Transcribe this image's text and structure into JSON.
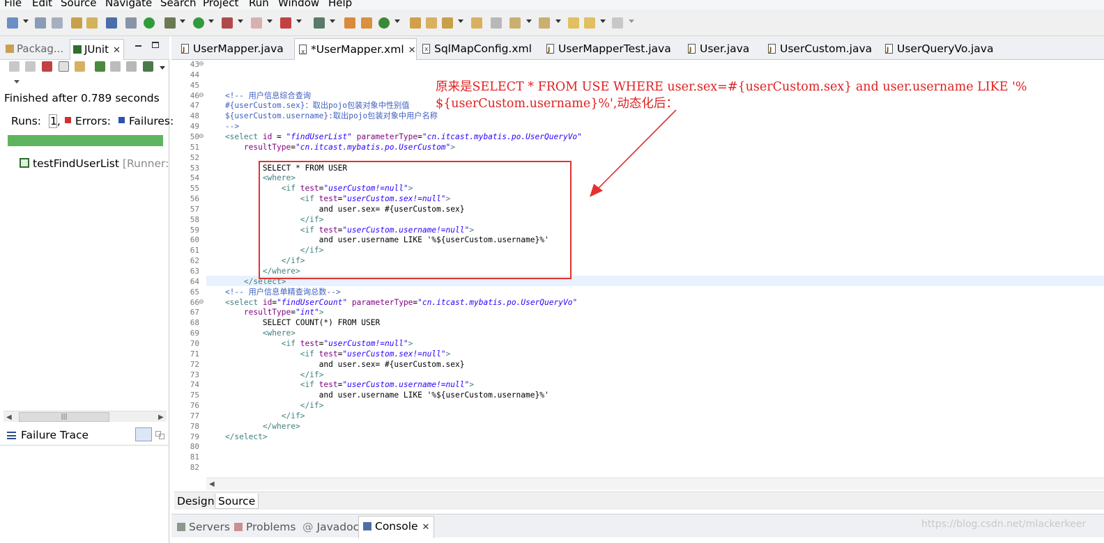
{
  "menu": [
    "File",
    "Edit",
    "Source",
    "Navigate",
    "Search",
    "Project",
    "Run",
    "Window",
    "Help"
  ],
  "left_panel": {
    "tabs": [
      {
        "label": "Packag..."
      },
      {
        "label": "JUnit",
        "close": "✕"
      }
    ],
    "status": "Finished after 0.789 seconds",
    "runs_label": "Runs:",
    "runs_value": "1,",
    "errors_label": "Errors:",
    "failures_label": "Failures:",
    "progress": 1.0,
    "progress_color": "#5fb55f",
    "tree_item": "testFindUserList",
    "tree_runner": "[Runner: JU",
    "failure_trace": "Failure Trace",
    "scroll_grip": "|||"
  },
  "editor_tabs": [
    {
      "label": "UserMapper.java",
      "type": "java",
      "active": false
    },
    {
      "label": "*UserMapper.xml",
      "type": "xml",
      "active": true,
      "close": "✕"
    },
    {
      "label": "SqlMapConfig.xml",
      "type": "xml",
      "active": false
    },
    {
      "label": "UserMapperTest.java",
      "type": "java",
      "active": false
    },
    {
      "label": "User.java",
      "type": "java",
      "active": false
    },
    {
      "label": "UserCustom.java",
      "type": "java",
      "active": false
    },
    {
      "label": "UserQueryVo.java",
      "type": "java",
      "active": false
    }
  ],
  "line_numbers": [
    "43",
    "44",
    "45",
    "46",
    "47",
    "48",
    "49",
    "50",
    "51",
    "52",
    "53",
    "54",
    "55",
    "56",
    "57",
    "58",
    "59",
    "60",
    "61",
    "62",
    "63",
    "64",
    "65",
    "66",
    "67",
    "68",
    "69",
    "70",
    "71",
    "72",
    "73",
    "74",
    "75",
    "76",
    "77",
    "78",
    "79",
    "80",
    "81",
    "82"
  ],
  "code": [
    [],
    [],
    [],
    [
      {
        "c": "comment",
        "t": "    <!-- 用户信息综合查询"
      }
    ],
    [
      {
        "c": "comment",
        "t": "    #{userCustom.sex}：取出pojo包装对象中性别值"
      }
    ],
    [
      {
        "c": "comment",
        "t": "    ${userCustom.username}:取出pojo包装对象中用户名称"
      }
    ],
    [
      {
        "c": "comment",
        "t": "    -->"
      }
    ],
    [
      {
        "c": "tag",
        "t": "    <select "
      },
      {
        "c": "attr",
        "t": "id"
      },
      {
        "c": "text",
        "t": " = "
      },
      {
        "c": "val",
        "t": "\"findUserList\""
      },
      {
        "c": "text",
        "t": " "
      },
      {
        "c": "attr",
        "t": "parameterType"
      },
      {
        "c": "text",
        "t": "="
      },
      {
        "c": "val",
        "t": "\"cn.itcast.mybatis.po.UserQueryVo\""
      }
    ],
    [
      {
        "c": "text",
        "t": "        "
      },
      {
        "c": "attr",
        "t": "resultType"
      },
      {
        "c": "text",
        "t": "="
      },
      {
        "c": "val",
        "t": "\"cn.itcast.mybatis.po.UserCustom\""
      },
      {
        "c": "tag",
        "t": ">"
      }
    ],
    [],
    [
      {
        "c": "text",
        "t": "            SELECT * FROM USER"
      }
    ],
    [
      {
        "c": "tag",
        "t": "            <where>"
      }
    ],
    [
      {
        "c": "tag",
        "t": "                <if "
      },
      {
        "c": "attr",
        "t": "test"
      },
      {
        "c": "text",
        "t": "="
      },
      {
        "c": "val",
        "t": "\"userCustom!=null\""
      },
      {
        "c": "tag",
        "t": ">"
      }
    ],
    [
      {
        "c": "tag",
        "t": "                    <if "
      },
      {
        "c": "attr",
        "t": "test"
      },
      {
        "c": "text",
        "t": "="
      },
      {
        "c": "val",
        "t": "\"userCustom.sex!=null\""
      },
      {
        "c": "tag",
        "t": ">"
      }
    ],
    [
      {
        "c": "text",
        "t": "                        and user.sex= #{userCustom.sex}"
      }
    ],
    [
      {
        "c": "tag",
        "t": "                    </if>"
      }
    ],
    [
      {
        "c": "tag",
        "t": "                    <if "
      },
      {
        "c": "attr",
        "t": "test"
      },
      {
        "c": "text",
        "t": "="
      },
      {
        "c": "val",
        "t": "\"userCustom.username!=null\""
      },
      {
        "c": "tag",
        "t": ">"
      }
    ],
    [
      {
        "c": "text",
        "t": "                        and user.username LIKE '%${userCustom.username}%'"
      }
    ],
    [
      {
        "c": "tag",
        "t": "                    </if>"
      }
    ],
    [
      {
        "c": "tag",
        "t": "                </if>"
      }
    ],
    [
      {
        "c": "tag",
        "t": "            </where>"
      }
    ],
    [
      {
        "c": "tag",
        "t": "        </select>"
      }
    ],
    [
      {
        "c": "comment",
        "t": "    <!-- 用户信息单精查询总数-->"
      }
    ],
    [
      {
        "c": "tag",
        "t": "    <select "
      },
      {
        "c": "attr",
        "t": "id"
      },
      {
        "c": "text",
        "t": "="
      },
      {
        "c": "val",
        "t": "\"findUserCount\""
      },
      {
        "c": "text",
        "t": " "
      },
      {
        "c": "attr",
        "t": "parameterType"
      },
      {
        "c": "text",
        "t": "="
      },
      {
        "c": "val",
        "t": "\"cn.itcast.mybatis.po.UserQueryVo\""
      }
    ],
    [
      {
        "c": "text",
        "t": "        "
      },
      {
        "c": "attr",
        "t": "resultType"
      },
      {
        "c": "text",
        "t": "="
      },
      {
        "c": "val",
        "t": "\"int\""
      },
      {
        "c": "tag",
        "t": ">"
      }
    ],
    [
      {
        "c": "text",
        "t": "            SELECT COUNT(*) FROM USER"
      }
    ],
    [
      {
        "c": "tag",
        "t": "            <where>"
      }
    ],
    [
      {
        "c": "tag",
        "t": "                <if "
      },
      {
        "c": "attr",
        "t": "test"
      },
      {
        "c": "text",
        "t": "="
      },
      {
        "c": "val",
        "t": "\"userCustom!=null\""
      },
      {
        "c": "tag",
        "t": ">"
      }
    ],
    [
      {
        "c": "tag",
        "t": "                    <if "
      },
      {
        "c": "attr",
        "t": "test"
      },
      {
        "c": "text",
        "t": "="
      },
      {
        "c": "val",
        "t": "\"userCustom.sex!=null\""
      },
      {
        "c": "tag",
        "t": ">"
      }
    ],
    [
      {
        "c": "text",
        "t": "                        and user.sex= #{userCustom.sex}"
      }
    ],
    [
      {
        "c": "tag",
        "t": "                    </if>"
      }
    ],
    [
      {
        "c": "tag",
        "t": "                    <if "
      },
      {
        "c": "attr",
        "t": "test"
      },
      {
        "c": "text",
        "t": "="
      },
      {
        "c": "val",
        "t": "\"userCustom.username!=null\""
      },
      {
        "c": "tag",
        "t": ">"
      }
    ],
    [
      {
        "c": "text",
        "t": "                        and user.username LIKE '%${userCustom.username}%'"
      }
    ],
    [
      {
        "c": "tag",
        "t": "                    </if>"
      }
    ],
    [
      {
        "c": "tag",
        "t": "                </if>"
      }
    ],
    [
      {
        "c": "tag",
        "t": "            </where>"
      }
    ],
    [
      {
        "c": "tag",
        "t": "    </select>"
      }
    ],
    [],
    [],
    []
  ],
  "annotation": {
    "text": "原来是SELECT * FROM USE WHERE user.sex=#{userCustom.sex} and user.username LIKE '%\n${userCustom.username}%',动态化后：",
    "color": "#e02020"
  },
  "design_tabs": [
    {
      "label": "Design",
      "active": false
    },
    {
      "label": "Source",
      "active": true
    }
  ],
  "bottom_tabs": [
    {
      "label": "Servers",
      "active": false
    },
    {
      "label": "Problems",
      "active": false
    },
    {
      "label": "Javadoc",
      "active": false
    },
    {
      "label": "Console",
      "active": true,
      "close": "✕"
    }
  ],
  "watermark": "https://blog.csdn.net/mlackerkeer"
}
